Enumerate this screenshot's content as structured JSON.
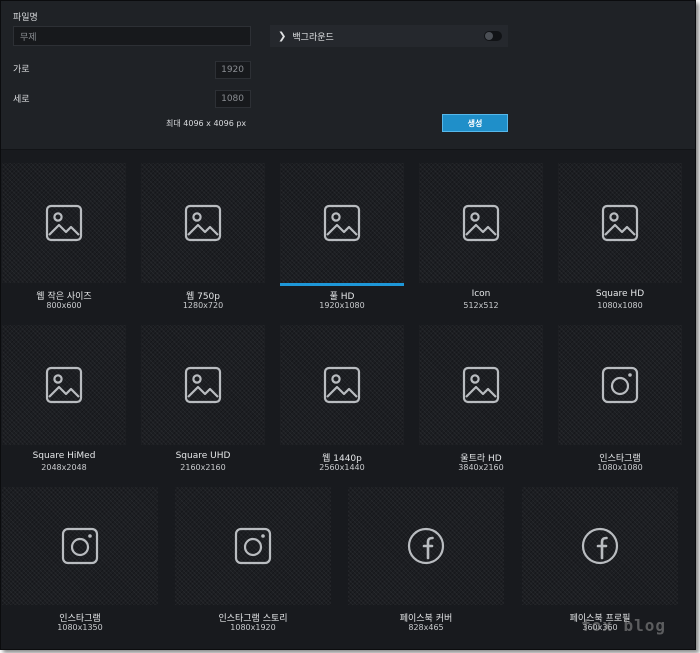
{
  "form": {
    "filename_label": "파일명",
    "filename_value": "무제",
    "width_label": "가로",
    "width_value": "1920",
    "height_label": "세로",
    "height_value": "1080",
    "max_note": "최대 4096 x 4096 px",
    "background_label": "백그라운드",
    "background_enabled": false,
    "create_label": "생성"
  },
  "presets": [
    {
      "name": "웹 작은 사이즈",
      "size": "800x600",
      "icon": "image-icon",
      "selected": false
    },
    {
      "name": "웹 750p",
      "size": "1280x720",
      "icon": "image-icon",
      "selected": false
    },
    {
      "name": "풀 HD",
      "size": "1920x1080",
      "icon": "image-icon",
      "selected": true
    },
    {
      "name": "Icon",
      "size": "512x512",
      "icon": "image-icon",
      "selected": false
    },
    {
      "name": "Square HD",
      "size": "1080x1080",
      "icon": "image-icon",
      "selected": false
    },
    {
      "name": "Square HiMed",
      "size": "2048x2048",
      "icon": "image-icon",
      "selected": false
    },
    {
      "name": "Square UHD",
      "size": "2160x2160",
      "icon": "image-icon",
      "selected": false
    },
    {
      "name": "웹 1440p",
      "size": "2560x1440",
      "icon": "image-icon",
      "selected": false
    },
    {
      "name": "울트라 HD",
      "size": "3840x2160",
      "icon": "image-icon",
      "selected": false
    },
    {
      "name": "인스타그램",
      "size": "1080x1080",
      "icon": "instagram-icon",
      "selected": false
    },
    {
      "name": "인스타그램",
      "size": "1080x1350",
      "icon": "instagram-icon",
      "selected": false
    },
    {
      "name": "인스타그램 스토리",
      "size": "1080x1920",
      "icon": "instagram-icon",
      "selected": false
    },
    {
      "name": "페이스북 커버",
      "size": "828x465",
      "icon": "facebook-icon",
      "selected": false
    },
    {
      "name": "페이스북 프로필",
      "size": "360x360",
      "icon": "facebook-icon",
      "selected": false
    }
  ],
  "watermark": "fox blog",
  "colors": {
    "accent": "#1f8fc9",
    "panel": "#1f2226",
    "background": "#181a1e"
  }
}
